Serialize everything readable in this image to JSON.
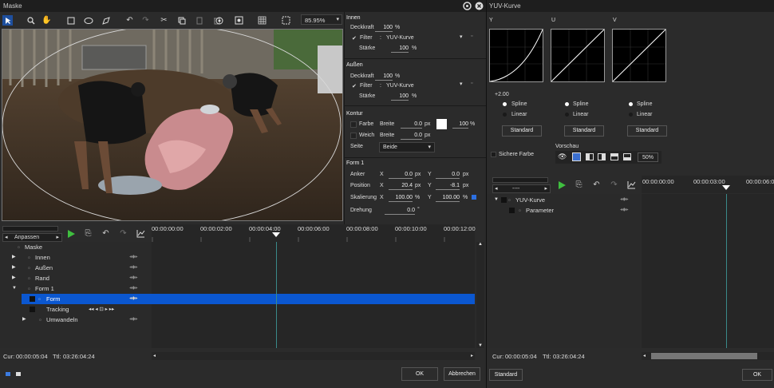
{
  "left_window": {
    "title": "Maske",
    "zoom": "85.95%",
    "innen": {
      "title": "Innen",
      "opacity_label": "Deckkraft",
      "opacity_value": "100",
      "opacity_unit": "%",
      "filter_label": "Filter",
      "filter_value": "YUV-Kurve",
      "strength_label": "Stärke",
      "strength_value": "100",
      "strength_unit": "%"
    },
    "aussen": {
      "title": "Außen",
      "opacity_label": "Deckkraft",
      "opacity_value": "100",
      "opacity_unit": "%",
      "filter_label": "Filter",
      "filter_value": "YUV-Kurve",
      "strength_label": "Stärke",
      "strength_value": "100",
      "strength_unit": "%"
    },
    "kontur": {
      "title": "Kontur",
      "color_label": "Farbe",
      "width_label": "Breite",
      "width_value": "0.0",
      "width_unit": "px",
      "color_pct": "100",
      "color_pct_unit": "%",
      "soft_label": "Weich",
      "soft_width_label": "Breite",
      "soft_width_value": "0.0",
      "soft_width_unit": "px",
      "side_label": "Seite",
      "side_value": "Beide"
    },
    "form": {
      "title": "Form 1",
      "anchor_label": "Anker",
      "anchor_x": "0.0",
      "anchor_y": "0.0",
      "position_label": "Position",
      "position_x": "20.4",
      "position_y": "-8.1",
      "scale_label": "Skalierung",
      "scale_x": "100.00",
      "scale_y": "100.00",
      "rotation_label": "Drehung",
      "rotation_value": "0.0",
      "unit_px": "px",
      "unit_pct": "%",
      "unit_deg": "°",
      "x_label": "X",
      "y_label": "Y"
    },
    "timeline": {
      "anpassen_label": "Anpassen",
      "ruler": [
        "00:00:00:00",
        "00:00:02:00",
        "00:00:04:00",
        "00:00:06:00",
        "00:00:08:00",
        "00:00:10:00",
        "00:00:12:00"
      ],
      "tree": [
        {
          "label": "Maske"
        },
        {
          "label": "Innen"
        },
        {
          "label": "Außen"
        },
        {
          "label": "Rand"
        },
        {
          "label": "Form 1"
        },
        {
          "label": "Form"
        },
        {
          "label": "Tracking"
        },
        {
          "label": "Umwandeln"
        }
      ],
      "cur_label": "Cur:",
      "cur_value": "00:00:05:04",
      "ttl_label": "Ttl:",
      "ttl_value": "03:26:04:24"
    },
    "ok_label": "OK",
    "cancel_label": "Abbrechen"
  },
  "right_window": {
    "title": "YUV-Kurve",
    "channels": [
      "Y",
      "U",
      "V"
    ],
    "gamma_value": "+2.00",
    "spline_label": "Spline",
    "linear_label": "Linear",
    "standard_label": "Standard",
    "safe_color_label": "Sichere Farbe",
    "preview_label": "Vorschau",
    "preview_zoom": "50%",
    "timeline": {
      "dropdown_value": "----",
      "ruler": [
        "00:00:00:00",
        "00:00:03:00",
        "00:00:06:00"
      ],
      "tree": [
        {
          "label": "YUV-Kurve"
        },
        {
          "label": "Parameter"
        }
      ],
      "cur_label": "Cur:",
      "cur_value": "00:00:05:04",
      "ttl_label": "Ttl:",
      "ttl_value": "03:26:04:24"
    },
    "standard_bottom_label": "Standard",
    "ok_label": "OK"
  },
  "colors": {
    "selection": "#0b57d0",
    "play_green": "#3fbf3f",
    "background": "#2b2b2b"
  }
}
